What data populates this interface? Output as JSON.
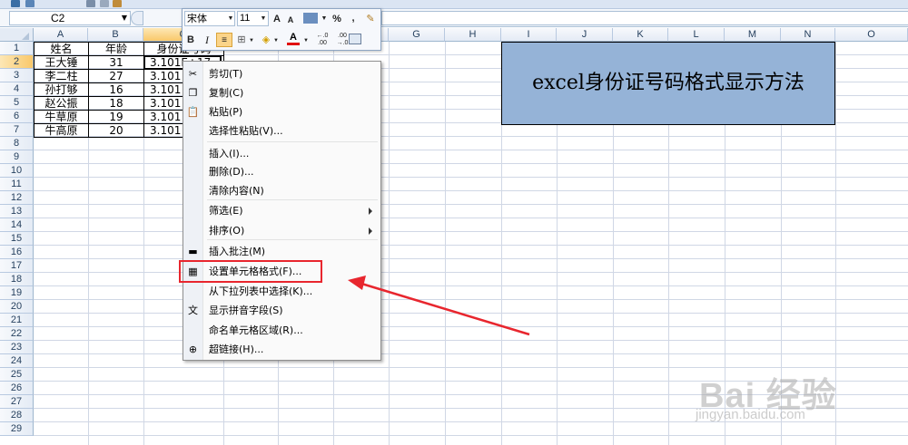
{
  "name_box": {
    "value": "C2"
  },
  "columns": [
    "A",
    "B",
    "C",
    "D",
    "E",
    "F",
    "G",
    "H",
    "I",
    "J",
    "K",
    "L",
    "M",
    "N",
    "O"
  ],
  "selected_column": "C",
  "rows": [
    1,
    2,
    3,
    4,
    5,
    6,
    7,
    8,
    9,
    10,
    11,
    12,
    13,
    14,
    15,
    16,
    17,
    18,
    19,
    20,
    21,
    22,
    23,
    24,
    25,
    26,
    27,
    28,
    29
  ],
  "selected_row": 2,
  "table": {
    "header": [
      "姓名",
      "年龄",
      "身份证号码"
    ],
    "rows": [
      [
        "王大锤",
        "31",
        "3.101E+17"
      ],
      [
        "李二柱",
        "27",
        "3.101"
      ],
      [
        "孙打够",
        "16",
        "3.101"
      ],
      [
        "赵公振",
        "18",
        "3.101"
      ],
      [
        "牛草原",
        "19",
        "3.101"
      ],
      [
        "牛高原",
        "20",
        "3.101"
      ]
    ]
  },
  "title_cell": {
    "text": "excel身份证号码格式显示方法",
    "fill_color": "#95b3d7"
  },
  "mini_toolbar": {
    "font_name": "宋体",
    "font_size": "11",
    "grow_font": "A",
    "shrink_font": "A",
    "percent": "%",
    "comma": ",",
    "bold": "B",
    "italic": "I",
    "font_color_label": "A",
    "increase_decimal": "←.0 .00",
    "decrease_decimal": ".00 →.0",
    "icons": [
      "grow-font-icon",
      "shrink-font-icon",
      "currency-format-icon",
      "format-painter-icon",
      "center-align-icon",
      "borders-icon",
      "fill-color-icon",
      "font-color-icon",
      "merge-center-icon"
    ]
  },
  "context_menu": {
    "items": [
      {
        "label": "剪切(T)",
        "icon": "scissors-icon"
      },
      {
        "label": "复制(C)",
        "icon": "copy-icon"
      },
      {
        "label": "粘贴(P)",
        "icon": "paste-icon"
      },
      {
        "label": "选择性粘贴(V)...",
        "icon": ""
      },
      {
        "label": "插入(I)...",
        "icon": ""
      },
      {
        "label": "删除(D)...",
        "icon": ""
      },
      {
        "label": "清除内容(N)",
        "icon": ""
      },
      {
        "label": "筛选(E)",
        "icon": "",
        "submenu": true
      },
      {
        "label": "排序(O)",
        "icon": "",
        "submenu": true
      },
      {
        "label": "插入批注(M)",
        "icon": "comment-icon"
      },
      {
        "label": "设置单元格格式(F)...",
        "icon": "format-cells-icon"
      },
      {
        "label": "从下拉列表中选择(K)...",
        "icon": ""
      },
      {
        "label": "显示拼音字段(S)",
        "icon": "phonetic-icon"
      },
      {
        "label": "命名单元格区域(R)...",
        "icon": ""
      },
      {
        "label": "超链接(H)...",
        "icon": "hyperlink-icon"
      }
    ],
    "highlighted_item": "设置单元格格式(F)..."
  },
  "annotation": {
    "color": "#e8262e"
  },
  "watermark": {
    "logo": "Bai 经验",
    "url": "jingyan.baidu.com"
  }
}
